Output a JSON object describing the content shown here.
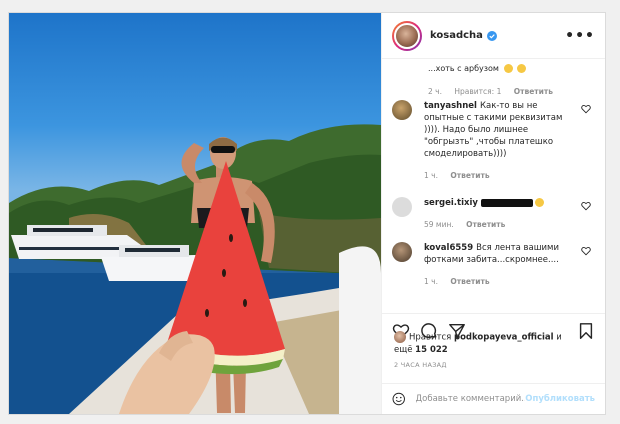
{
  "post": {
    "username": "kosadcha",
    "more_label": "•••",
    "truncated_comment": "...хоть с арбузом",
    "first_meta": {
      "time": "2 ч.",
      "likes": "Нравится: 1",
      "reply": "Ответить"
    },
    "comments": [
      {
        "user": "tanyashnel",
        "text": "Как-то вы не опытные с такими реквизитам )))). Надо было лишнее \"обгрызть\" ,чтобы платешко смоделировать))))",
        "time": "1 ч.",
        "reply": "Ответить"
      },
      {
        "user": "sergei.tixiy",
        "text": "",
        "time": "59 мин.",
        "reply": "Ответить"
      },
      {
        "user": "koval6559",
        "text": "Вся лента вашими фотками забита...скромнее....",
        "time": "1 ч.",
        "reply": "Ответить"
      }
    ],
    "likes_prefix": "Нравится",
    "likes_user": "podkopayeva_official",
    "likes_and": "и",
    "likes_more_prefix": "ещё",
    "likes_count": "15 022",
    "time_ago": "2 ЧАСА НАЗАД",
    "comment_placeholder": "Добавьте комментарий...",
    "publish_label": "Опубликовать"
  },
  "icons": [
    "verified-icon",
    "more-icon",
    "heart-icon",
    "comment-icon",
    "share-icon",
    "bookmark-icon",
    "smile-icon"
  ],
  "colors": {
    "verified": "#3897f0",
    "publish": "#b2dffc",
    "muted": "#8e8e8e"
  }
}
